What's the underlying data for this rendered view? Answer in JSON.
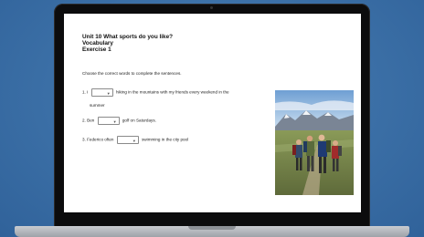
{
  "exercise": {
    "title": "Unit 10 What sports do you like?",
    "section": "Vocabulary",
    "exercise_label": "Exercise 1",
    "instructions": "Choose the correct words to complete the sentences.",
    "questions": [
      {
        "number": "1.",
        "before": "I",
        "after": "hiking in the mountains with my friends every weekend in the",
        "continuation": "summer",
        "selected": ""
      },
      {
        "number": "2.",
        "before": "Ben",
        "after": "golf on Saturdays.",
        "selected": ""
      },
      {
        "number": "3.",
        "before": "Federico often",
        "after": "swimming in the city pool",
        "selected": ""
      }
    ]
  },
  "photo": {
    "icon": "hikers-photo"
  }
}
